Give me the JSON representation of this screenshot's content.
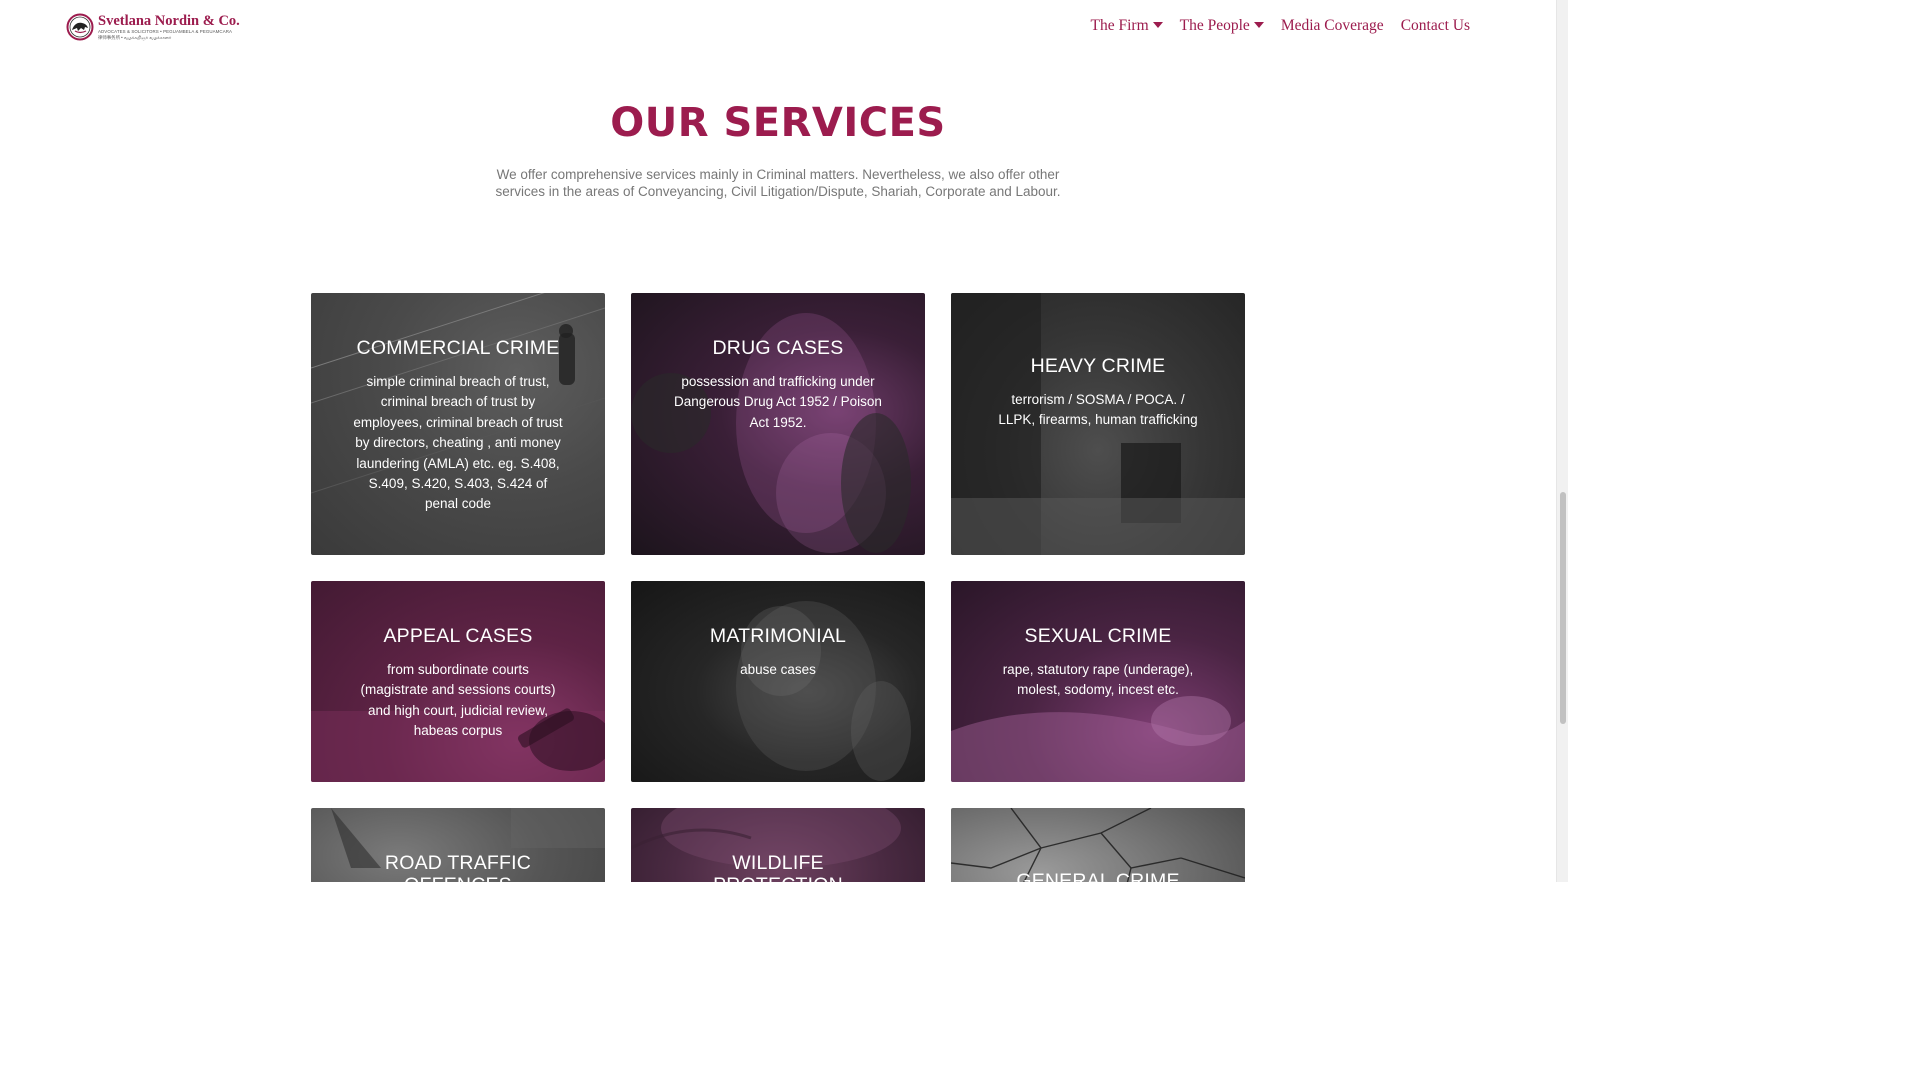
{
  "header": {
    "logo": {
      "name": "Svetlana Nordin & Co.",
      "subtitle": "ADVOCATES & SOLICITORS • PEGUAMBELA & PEGUAMCARA",
      "subtitle2": "律师事务所 • வழக்கறிஞர் வழக்காளர்"
    },
    "nav": [
      {
        "label": "The Firm",
        "has_dropdown": true
      },
      {
        "label": "The People",
        "has_dropdown": true
      },
      {
        "label": "Media Coverage",
        "has_dropdown": false
      },
      {
        "label": "Contact Us",
        "has_dropdown": false
      }
    ]
  },
  "services": {
    "title": "OUR SERVICES",
    "description": "We offer comprehensive services mainly in Criminal matters. Nevertheless, we also offer other services in the areas of Conveyancing, Civil Litigation/Dispute, Shariah, Corporate and Labour.",
    "cards": [
      {
        "title": "COMMERCIAL CRIME",
        "text": "simple criminal breach of trust, criminal breach of trust by employees, criminal breach of trust by directors, cheating , anti money laundering (AMLA) etc. eg. S.408, S.409, S.420, S.403, S.424 of penal code"
      },
      {
        "title": "DRUG CASES",
        "text": "possession and trafficking under Dangerous Drug Act 1952 / Poison Act 1952."
      },
      {
        "title": "HEAVY CRIME",
        "text": "terrorism / SOSMA / POCA. / LLPK, firearms, human trafficking"
      },
      {
        "title": "APPEAL CASES",
        "text": "from subordinate courts (magistrate and sessions courts) and high court, judicial review, habeas corpus"
      },
      {
        "title": "MATRIMONIAL",
        "text": "abuse cases"
      },
      {
        "title": "SEXUAL CRIME",
        "text": "rape, statutory rape (underage), molest, sodomy, incest etc."
      },
      {
        "title": "ROAD TRAFFIC OFFENCES",
        "text": ""
      },
      {
        "title": "WILDLIFE PROTECTION OFFENCES",
        "text": ""
      },
      {
        "title": "GENERAL CRIME",
        "text": ""
      }
    ]
  },
  "colors": {
    "brand": "#9c1c4e",
    "text_muted": "#777777"
  }
}
